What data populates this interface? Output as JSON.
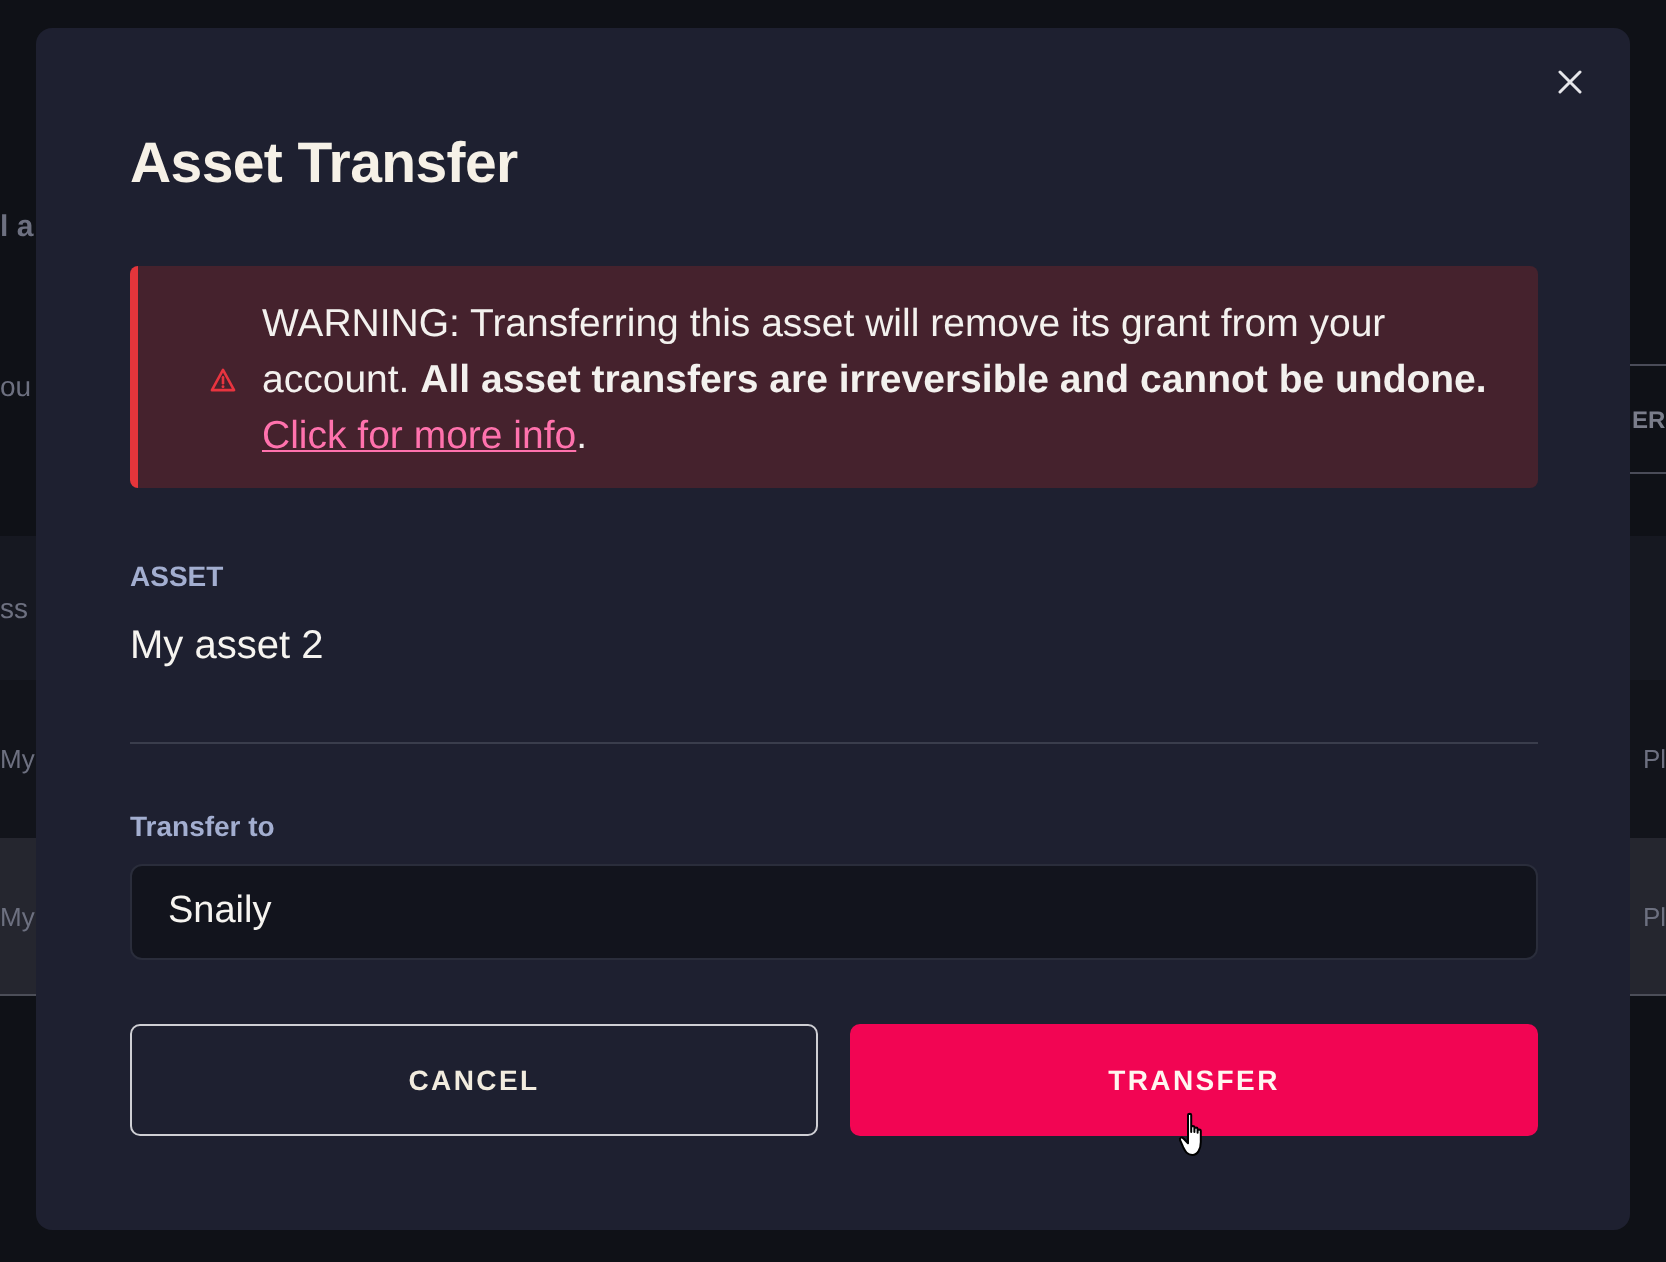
{
  "page_behind": {
    "heading_fragment": "l a",
    "text_fragment": "ou",
    "button_fragment": "ER",
    "table": {
      "header_fragment": "ss",
      "rows": [
        {
          "column_1": "My",
          "column_2": "Pl",
          "highlighted": false
        },
        {
          "column_1": "My",
          "column_2": "Pl",
          "highlighted": true
        }
      ]
    }
  },
  "modal": {
    "title": "Asset Transfer",
    "alert": {
      "kind": "warning",
      "text": "WARNING: Transferring this asset will remove its grant from your account. **All asset transfers are irreversible and cannot be undone.**",
      "link": "Click for more info",
      "after_link": "."
    },
    "fields": [
      {
        "kind": "static",
        "label": "ASSET",
        "value": "My asset 2"
      },
      {
        "kind": "input",
        "label": "Transfer to",
        "value": "Snaily"
      }
    ],
    "buttons": [
      {
        "kind": "secondary",
        "label": "CANCEL"
      },
      {
        "kind": "primary",
        "label": "TRANSFER"
      }
    ]
  }
}
